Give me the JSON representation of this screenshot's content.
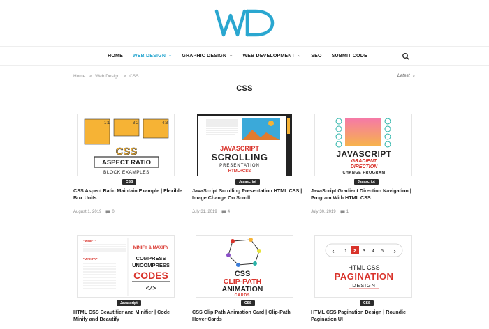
{
  "logo": {
    "text": "WD",
    "colors": {
      "primary": "#2aa7d0"
    }
  },
  "nav": {
    "items": [
      {
        "label": "HOME",
        "dropdown": false,
        "active": false
      },
      {
        "label": "WEB DESIGN",
        "dropdown": true,
        "active": true
      },
      {
        "label": "GRAPHIC DESIGN",
        "dropdown": true,
        "active": false
      },
      {
        "label": "WEB DEVELOPMENT",
        "dropdown": true,
        "active": false
      },
      {
        "label": "SEO",
        "dropdown": false,
        "active": false
      },
      {
        "label": "SUBMIT CODE",
        "dropdown": false,
        "active": false
      }
    ],
    "search_icon": "search-icon"
  },
  "breadcrumb": {
    "home": "Home",
    "sep": ">",
    "parent": "Web Design",
    "current": "CSS"
  },
  "sort": {
    "label": "Latest"
  },
  "page_title": "CSS",
  "posts": [
    {
      "category": "CSS",
      "title": "CSS Aspect Ratio Maintain Example | Flexible Box Units",
      "date": "August 1, 2019",
      "comments": "0",
      "thumb": {
        "big": "CSS",
        "line1": "ASPECT RATIO",
        "line2": "BLOCK EXAMPLES",
        "r1": "1:1",
        "r2": "3:2",
        "r3": "4:3"
      }
    },
    {
      "category": "Javascript",
      "title": "JavaScript Scrolling Presentation HTML CSS | Image Change On Scroll",
      "date": "July 31, 2019",
      "comments": "4",
      "thumb": {
        "l1": "JAVASCRIPT",
        "l2": "SCROLLING",
        "l3": "PRESENTATION",
        "l4": "HTML+CSS"
      }
    },
    {
      "category": "Javascript",
      "title": "JavaScript Gradient Direction Navigation | Program With HTML CSS",
      "date": "July 30, 2019",
      "comments": "1",
      "thumb": {
        "l1": "JAVASCRIPT",
        "l2": "GRADIENT",
        "l3": "DIRECTION",
        "l4": "CHANGE PROGRAM"
      }
    },
    {
      "category": "Javascript",
      "title": "HTML CSS Beautifier and Minifier | Code Minify and Beautify",
      "thumb": {
        "t1": "*MINIFY*",
        "t2": "*MAXIFY*",
        "l1": "MINIFY & MAXIFY",
        "l2": "COMPRESS",
        "l3": "UNCOMPRESS",
        "l4": "CODES",
        "l5": "</>"
      }
    },
    {
      "category": "CSS",
      "title": "CSS Clip Path Animation Card | Clip-Path Hover Cards",
      "thumb": {
        "l1": "CSS",
        "l2": "CLIP-PATH",
        "l3": "ANIMATION",
        "l4": "CARDS"
      }
    },
    {
      "category": "CSS",
      "title": "HTML CSS Pagination Design | Roundie Pagination UI",
      "thumb": {
        "p1": "1",
        "p2": "2",
        "p3": "3",
        "p4": "4",
        "p5": "5",
        "l1": "HTML CSS",
        "l2": "PAGINATION",
        "l3": "DESIGN"
      }
    }
  ]
}
